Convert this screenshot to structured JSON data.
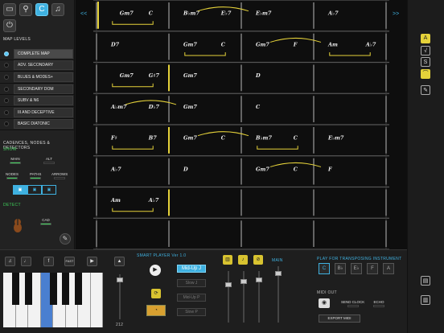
{
  "toolbar": {
    "icons": [
      {
        "name": "folder-icon",
        "glyph": "▭"
      },
      {
        "name": "pin-icon",
        "glyph": "⚲"
      },
      {
        "name": "c-key-icon",
        "glyph": "C",
        "active": true
      },
      {
        "name": "music-note-icon",
        "glyph": "♫"
      }
    ],
    "power_glyph": "⏻"
  },
  "map_levels": {
    "title": "MAP LEVELS",
    "items": [
      {
        "label": "COMPLETE MAP",
        "active": true
      },
      {
        "label": "ADV. SECONDARY",
        "active": false
      },
      {
        "label": "BLUES & MODES+",
        "active": false
      },
      {
        "label": "SECONDARY DOM",
        "active": false
      },
      {
        "label": "SUBV & N6",
        "active": false
      },
      {
        "label": "III AND DECEPTIVE",
        "active": false
      },
      {
        "label": "BASIC DIATONIC",
        "active": false
      }
    ]
  },
  "detectors": {
    "title": "CADENCES, NODES & DETECTORS",
    "show_label": "SHOW",
    "main": "MAIN",
    "alt": "ALT",
    "nodes": "NODES",
    "paths": "PATHS",
    "arrows": "ARROWS",
    "tabs": [
      "▣",
      "▣",
      "▣"
    ],
    "detect_label": "DETECT",
    "cad": "CAD"
  },
  "grid": {
    "nav_prev": "<<",
    "nav_next": ">>",
    "rows": [
      [
        [
          "",
          "Gm7",
          "C"
        ],
        [
          "B♭m7",
          "E♭7"
        ],
        [
          "E♭m7",
          ""
        ],
        [
          "A♭7",
          ""
        ]
      ],
      [
        [
          "D7",
          ""
        ],
        [
          "Gm7",
          "C"
        ],
        [
          "Gm7",
          "F"
        ],
        [
          "Am",
          "A♭7"
        ]
      ],
      [
        [
          "",
          "Gm7",
          "G♯7"
        ],
        [
          "Gm7",
          ""
        ],
        [
          "D",
          ""
        ],
        [
          "",
          ""
        ]
      ],
      [
        [
          "A♭m7",
          "D♭7"
        ],
        [
          "Gm7",
          ""
        ],
        [
          "C",
          ""
        ],
        [
          "",
          ""
        ]
      ],
      [
        [
          "F♯",
          "B7"
        ],
        [
          "Gm7",
          "C"
        ],
        [
          "B♭m7",
          "C"
        ],
        [
          "E♭m7",
          ""
        ]
      ],
      [
        [
          "A♭7",
          ""
        ],
        [
          "D",
          ""
        ],
        [
          "Gm7",
          "C"
        ],
        [
          "F",
          ""
        ]
      ],
      [
        [
          "Am",
          "A♭7"
        ],
        [
          "",
          ""
        ],
        [
          "",
          ""
        ],
        [
          "",
          ""
        ]
      ],
      [
        [
          "",
          ""
        ],
        [
          "",
          ""
        ],
        [
          "",
          ""
        ],
        [
          "",
          ""
        ]
      ]
    ],
    "accent": "#e5d23a"
  },
  "right_tools": [
    {
      "name": "a-text-icon",
      "glyph": "A"
    },
    {
      "name": "sqrt-icon",
      "glyph": "√"
    },
    {
      "name": "s-icon",
      "glyph": "S"
    },
    {
      "name": "lasso-icon",
      "glyph": "⌒"
    },
    {
      "name": "pen-icon",
      "glyph": "✎"
    }
  ],
  "bottom": {
    "icons": [
      "♫",
      "♩",
      "f",
      "FAST",
      "▶"
    ],
    "smart_player_label": "SMART PLAYER Ver 1.0",
    "styles": [
      "Mid-Up J",
      "Slow J",
      "Mid-Up P",
      "Slow P"
    ],
    "tempo": "212",
    "main_label": "MAIN",
    "transpose_label": "PLAY FOR TRANSPOSING INSTRUMENT",
    "transpose_keys": [
      "C",
      "B♭",
      "E♭",
      "F",
      "A"
    ],
    "midi_out": "MIDI OUT",
    "send_clock": "SEND CLOCK",
    "echo": "ECHO",
    "export": "EXPORT MIDI"
  }
}
